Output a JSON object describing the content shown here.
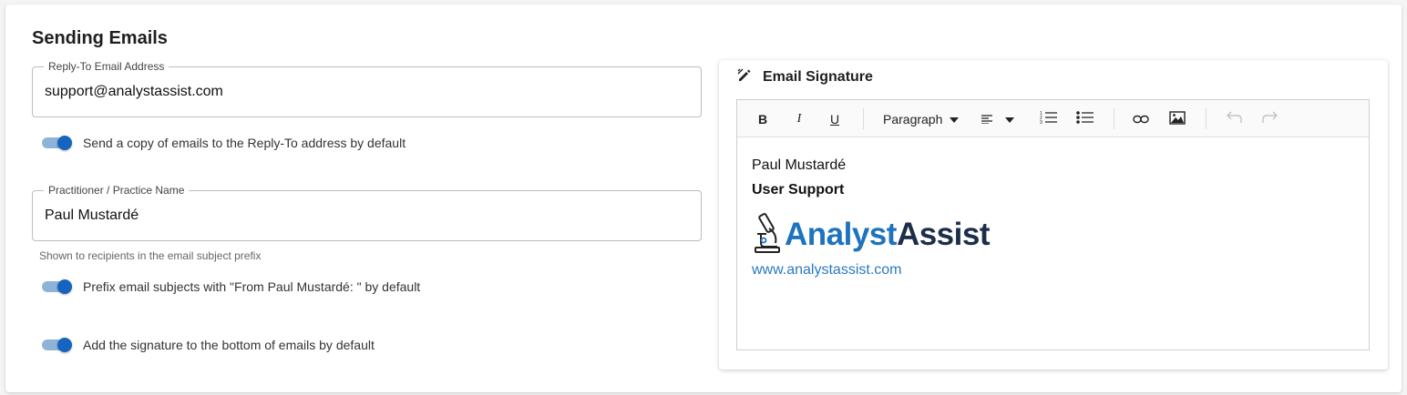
{
  "section": {
    "title": "Sending Emails"
  },
  "reply_to": {
    "label": "Reply-To Email Address",
    "value": "support@analystassist.com"
  },
  "toggles": {
    "send_copy": {
      "label": "Send a copy of emails to the Reply-To address by default",
      "checked": true
    },
    "prefix_subject": {
      "label": "Prefix email subjects with \"From Paul Mustardé: \" by default",
      "checked": true
    },
    "add_signature": {
      "label": "Add the signature to the bottom of emails by default",
      "checked": true
    }
  },
  "practice_name": {
    "label": "Practitioner / Practice Name",
    "value": "Paul Mustardé",
    "helper": "Shown to recipients in the email subject prefix"
  },
  "signature": {
    "title": "Email Signature",
    "icons": {
      "header": "signature-pen-icon",
      "bold": "bold-icon",
      "italic": "italic-icon",
      "underline": "underline-icon",
      "align": "align-left-icon",
      "numbered": "numbered-list-icon",
      "bulleted": "bulleted-list-icon",
      "link": "link-icon",
      "image": "image-icon",
      "undo": "undo-icon",
      "redo": "redo-icon"
    },
    "toolbar": {
      "bold": "B",
      "italic": "I",
      "underline": "U",
      "paragraph": "Paragraph"
    },
    "content": {
      "name": "Paul Mustardé",
      "role": "User Support",
      "logo_part1": "Analyst",
      "logo_part2": "Assist",
      "website": "www.analystassist.com"
    }
  },
  "colors": {
    "accent": "#1565c0",
    "toggle_track": "#8fb2d8",
    "logo_blue": "#1e73be",
    "logo_navy": "#1c2e4a",
    "link": "#2a79c2"
  }
}
